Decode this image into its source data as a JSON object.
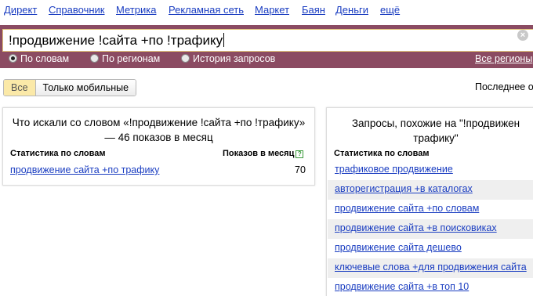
{
  "nav": {
    "items": [
      "Директ",
      "Справочник",
      "Метрика",
      "Рекламная сеть",
      "Маркет",
      "Баян",
      "Деньги",
      "ещё"
    ]
  },
  "search": {
    "query": "!продвижение !сайта +по !трафику"
  },
  "scope": {
    "by_words": "По словам",
    "by_regions": "По регионам",
    "history": "История запросов",
    "all_regions": "Все регионы",
    "selected": "by_words"
  },
  "filter": {
    "all": "Все",
    "mobile": "Только мобильные",
    "last_label": "Последнее о"
  },
  "left_panel": {
    "title": "Что искали со словом «!продвижение !сайта +по !трафику» — 46 показов в месяц",
    "col_stats": "Статистика по словам",
    "col_shows": "Показов в месяц",
    "help": "?",
    "rows": [
      {
        "phrase": "продвижение сайта +по трафику",
        "count": "70"
      }
    ]
  },
  "right_panel": {
    "title_line1": "Запросы, похожие на \"!продвижен",
    "title_line2": "трафику\"",
    "col_stats": "Статистика по словам",
    "rows": [
      "трафиковое продвижение",
      "авторегистрация +в каталогах",
      "продвижение сайта +по словам",
      "продвижение сайта +в поисковиках",
      "продвижение сайта дешево",
      "ключевые слова +для продвижения сайта",
      "продвижение сайта +в топ 10"
    ]
  },
  "colors": {
    "search_bar": "#8b4b62",
    "link": "#1a3dc1",
    "active_filter": "#fbe9a8"
  }
}
